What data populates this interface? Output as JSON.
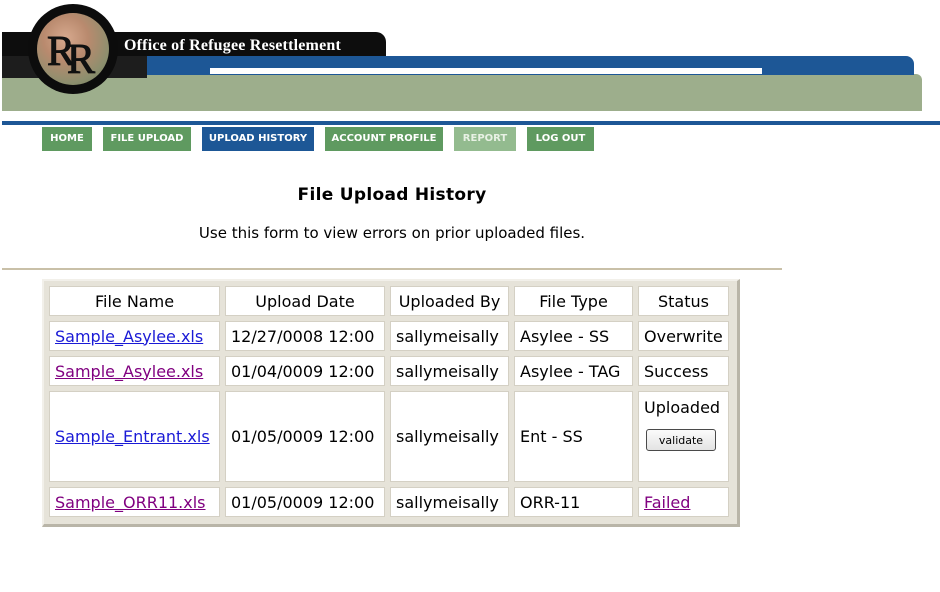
{
  "header": {
    "site_title": "Office of Refugee Resettlement",
    "logo_icon": "orr-logo-icon",
    "colors": {
      "brand_blue": "#1d5796",
      "brand_green": "#9dae8c",
      "nav_green": "#5f9a60"
    }
  },
  "nav": {
    "items": [
      {
        "label": "HOME",
        "state": "normal"
      },
      {
        "label": "FILE UPLOAD",
        "state": "normal"
      },
      {
        "label": "UPLOAD HISTORY",
        "state": "active"
      },
      {
        "label": "ACCOUNT PROFILE",
        "state": "normal"
      },
      {
        "label": "REPORT",
        "state": "disabled"
      },
      {
        "label": "LOG OUT",
        "state": "normal"
      }
    ]
  },
  "page": {
    "title": "File Upload History",
    "subtitle": "Use this form to view errors on prior uploaded files."
  },
  "table": {
    "headers": [
      "File Name",
      "Upload Date",
      "Uploaded By",
      "File Type",
      "Status"
    ],
    "rows": [
      {
        "file_name": "Sample_Asylee.xls",
        "upload_date": "12/27/0008 12:00",
        "uploaded_by": "sallymeisally",
        "file_type": "Asylee - SS",
        "status": "Overwrite"
      },
      {
        "file_name": "Sample_Asylee.xls",
        "upload_date": "01/04/0009 12:00",
        "uploaded_by": "sallymeisally",
        "file_type": "Asylee - TAG",
        "status": "Success"
      },
      {
        "file_name": "Sample_Entrant.xls",
        "upload_date": "01/05/0009 12:00",
        "uploaded_by": "sallymeisally",
        "file_type": "Ent - SS",
        "status": "Uploaded",
        "action_label": "validate"
      },
      {
        "file_name": "Sample_ORR11.xls",
        "upload_date": "01/05/0009 12:00",
        "uploaded_by": "sallymeisally",
        "file_type": "ORR-11",
        "status": "Failed"
      }
    ]
  }
}
